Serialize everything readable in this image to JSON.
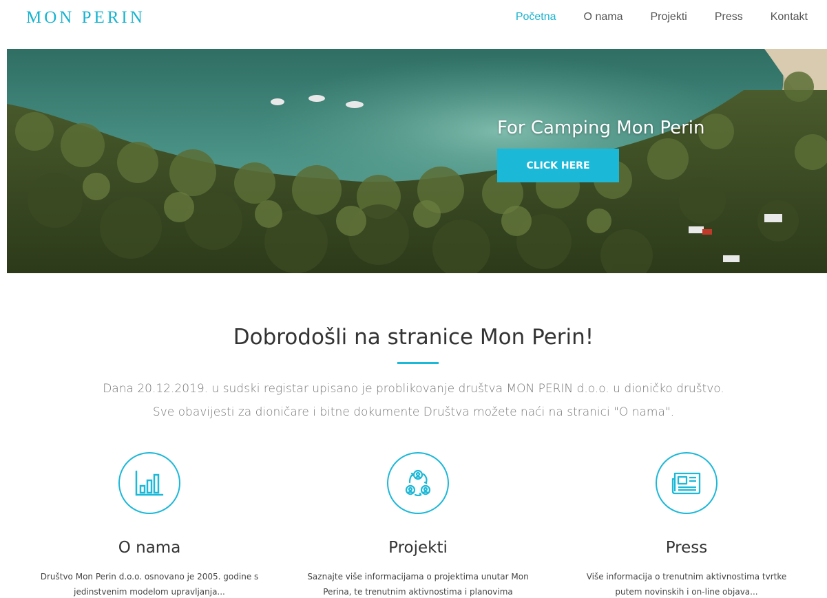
{
  "header": {
    "logo": "MON PERIN",
    "nav": [
      {
        "label": "Početna",
        "active": true
      },
      {
        "label": "O nama",
        "active": false
      },
      {
        "label": "Projekti",
        "active": false
      },
      {
        "label": "Press",
        "active": false
      },
      {
        "label": "Kontakt",
        "active": false
      }
    ]
  },
  "hero": {
    "title": "For Camping Mon Perin",
    "button_label": "CLICK HERE"
  },
  "welcome": {
    "title": "Dobrodošli na stranice Mon Perin!",
    "line1": "Dana 20.12.2019. u sudski registar upisano je problikovanje društva MON PERIN d.o.o. u dioničko društvo.",
    "line2": "Sve obavijesti za dioničare i bitne dokumente Društva možete naći na stranici \"O nama\"."
  },
  "features": [
    {
      "icon": "bar-chart-icon",
      "title": "O nama",
      "line1": "Društvo Mon Perin d.o.o. osnovano je 2005. godine s",
      "line2": "jedinstvenim modelom upravljanja..."
    },
    {
      "icon": "people-cycle-icon",
      "title": "Projekti",
      "line1": "Saznajte više informacijama o projektima unutar Mon",
      "line2": "Perina, te trenutnim aktivnostima i planovima"
    },
    {
      "icon": "newspaper-icon",
      "title": "Press",
      "line1": "Više informacija o trenutnim aktivnostima tvrtke",
      "line2": "putem novinskih i on-line objava..."
    }
  ],
  "colors": {
    "accent": "#1cb8d8",
    "text": "#333333",
    "muted": "#777777"
  }
}
